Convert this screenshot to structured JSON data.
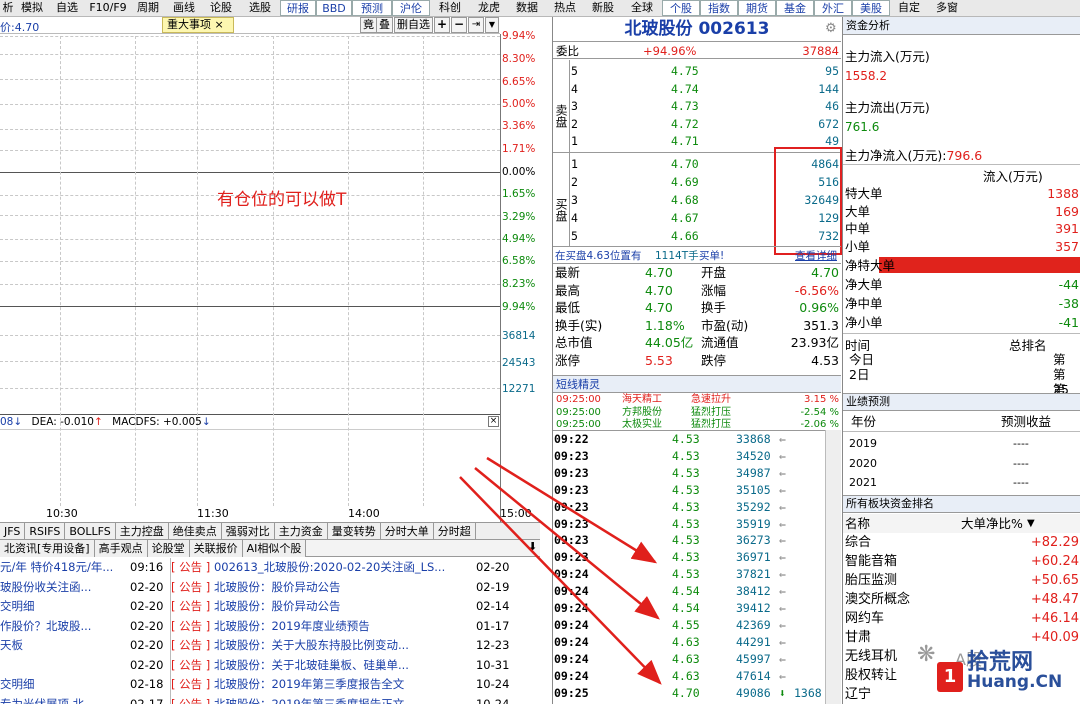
{
  "menu": [
    "析",
    "模拟",
    "自选",
    "F10/F9",
    "周期",
    "画线",
    "论股",
    "选股",
    "研报",
    "BBD",
    "预测",
    "沪伦",
    "科创",
    "龙虎",
    "数据",
    "热点",
    "新股",
    "全球",
    "个股",
    "指数",
    "期货",
    "基金",
    "外汇",
    "美股",
    "自定",
    "多窗"
  ],
  "chart": {
    "price_label": "价:4.70",
    "tag": "重大事项",
    "tag_close": "×",
    "buttons": [
      "竟",
      "叠",
      "删自选"
    ],
    "annotation": "有仓位的可以做T",
    "right_axis": [
      "9.94%",
      "8.30%",
      "6.65%",
      "5.00%",
      "3.36%",
      "1.71%",
      "0.00%",
      "1.65%",
      "3.29%",
      "4.94%",
      "6.58%",
      "8.23%",
      "9.94%"
    ],
    "vol_axis": [
      "36814",
      "24543",
      "12271"
    ],
    "ind_line": {
      "a": "08",
      "dea": "DEA: -0.010",
      "macd": "MACDFS: +0.005"
    },
    "times": [
      "10:30",
      "11:30",
      "14:00",
      "15:00"
    ],
    "ind_tabs": [
      "JFS",
      "RSIFS",
      "BOLLFS",
      "主力控盘",
      "绝佳卖点",
      "强弱对比",
      "主力资金",
      "量变转势",
      "分时大单",
      "分时超"
    ]
  },
  "news": {
    "tabs": [
      "北资讯[专用设备]",
      "高手观点",
      "论股堂",
      "关联报价",
      "AI相似个股"
    ],
    "left": [
      {
        "t": "元/年 特价418元/年...",
        "d": "09:16"
      },
      {
        "t": "玻股份收关注函...",
        "d": "02-20"
      },
      {
        "t": "交明细",
        "d": "02-20"
      },
      {
        "t": "作股价？北玻股...",
        "d": "02-20"
      },
      {
        "t": "天板",
        "d": "02-20"
      },
      {
        "t": "",
        "d": "02-20"
      },
      {
        "t": "交明细",
        "d": "02-18"
      },
      {
        "t": "专为光伏展项 北...",
        "d": "02-17"
      }
    ],
    "right": [
      {
        "tag": "公告",
        "t": "002613_北玻股份:2020-02-20关注函_LS...",
        "d": "02-20"
      },
      {
        "tag": "公告",
        "t": "北玻股份：股价异动公告",
        "d": "02-19"
      },
      {
        "tag": "公告",
        "t": "北玻股份：股价异动公告",
        "d": "02-14"
      },
      {
        "tag": "公告",
        "t": "北玻股份：2019年度业绩预告",
        "d": "01-17"
      },
      {
        "tag": "公告",
        "t": "北玻股份：关于大股东持股比例变动...",
        "d": "12-23"
      },
      {
        "tag": "公告",
        "t": "北玻股份：关于北玻硅巢板、硅巢单...",
        "d": "10-31"
      },
      {
        "tag": "公告",
        "t": "北玻股份：2019年第三季度报告全文",
        "d": "10-24"
      },
      {
        "tag": "公告",
        "t": "北玻股份：2019年第三季度报告正文",
        "d": "10-24"
      }
    ]
  },
  "quote": {
    "name": "北玻股份 002613",
    "weibi": {
      "label": "委比",
      "pct": "+94.96%",
      "val": "37884"
    },
    "sell_label": "卖盘",
    "buy_label": "买盘",
    "sell": [
      {
        "n": "5",
        "p": "4.75",
        "v": "95"
      },
      {
        "n": "4",
        "p": "4.74",
        "v": "144"
      },
      {
        "n": "3",
        "p": "4.73",
        "v": "46"
      },
      {
        "n": "2",
        "p": "4.72",
        "v": "672"
      },
      {
        "n": "1",
        "p": "4.71",
        "v": "49"
      }
    ],
    "buy": [
      {
        "n": "1",
        "p": "4.70",
        "v": "4864"
      },
      {
        "n": "2",
        "p": "4.69",
        "v": "516"
      },
      {
        "n": "3",
        "p": "4.68",
        "v": "32649"
      },
      {
        "n": "4",
        "p": "4.67",
        "v": "129"
      },
      {
        "n": "5",
        "p": "4.66",
        "v": "732"
      }
    ],
    "status": {
      "a": "在买盘4.63位置有",
      "b": "1114T手",
      "c": "买单!",
      "d": "查看详细"
    },
    "stats": [
      [
        "最新",
        "4.70",
        "开盘",
        "4.70"
      ],
      [
        "最高",
        "4.70",
        "涨幅",
        "-6.56%"
      ],
      [
        "最低",
        "4.70",
        "换手",
        "0.96%"
      ],
      [
        "换手(实)",
        "1.18%",
        "市盈(动)",
        "351.3"
      ],
      [
        "总市值",
        "44.05亿",
        "流通值",
        "23.93亿"
      ],
      [
        "涨停",
        "5.53",
        "跌停",
        "4.53"
      ]
    ],
    "sprite_title": "短线精灵",
    "sprite": [
      {
        "t": "09:25:00",
        "n": "海天精工",
        "e": "急速拉升",
        "v": "3.15 %"
      },
      {
        "t": "09:25:00",
        "n": "方邦股份",
        "e": "猛烈打压",
        "v": "-2.54 %"
      },
      {
        "t": "09:25:00",
        "n": "太极实业",
        "e": "猛烈打压",
        "v": "-2.06 %"
      }
    ],
    "ticks": [
      {
        "t": "09:22",
        "p": "4.53",
        "v": "33868"
      },
      {
        "t": "09:23",
        "p": "4.53",
        "v": "34520"
      },
      {
        "t": "09:23",
        "p": "4.53",
        "v": "34987"
      },
      {
        "t": "09:23",
        "p": "4.53",
        "v": "35105"
      },
      {
        "t": "09:23",
        "p": "4.53",
        "v": "35292"
      },
      {
        "t": "09:23",
        "p": "4.53",
        "v": "35919"
      },
      {
        "t": "09:23",
        "p": "4.53",
        "v": "36273"
      },
      {
        "t": "09:23",
        "p": "4.53",
        "v": "36971"
      },
      {
        "t": "09:24",
        "p": "4.53",
        "v": "37821"
      },
      {
        "t": "09:24",
        "p": "4.54",
        "v": "38412"
      },
      {
        "t": "09:24",
        "p": "4.54",
        "v": "39412"
      },
      {
        "t": "09:24",
        "p": "4.55",
        "v": "42369"
      },
      {
        "t": "09:24",
        "p": "4.63",
        "v": "44291"
      },
      {
        "t": "09:24",
        "p": "4.63",
        "v": "45997"
      },
      {
        "t": "09:24",
        "p": "4.63",
        "v": "47614"
      },
      {
        "t": "09:25",
        "p": "4.70",
        "v": "49086",
        "x": "1368"
      }
    ]
  },
  "funds": {
    "title": "资金分析",
    "in_label": "主力流入(万元)",
    "in_val": "1558.2",
    "out_label": "主力流出(万元)",
    "out_val": "761.6",
    "net_label": "主力净流入(万元):",
    "net_val": "796.6",
    "flow_head": "流入(万元)",
    "flow": [
      [
        "特大单",
        "1388"
      ],
      [
        "大单",
        "169"
      ],
      [
        "中单",
        "391"
      ],
      [
        "小单",
        "357"
      ]
    ],
    "net": [
      [
        "净特大单",
        ""
      ],
      [
        "净大单",
        "-44"
      ],
      [
        "净中单",
        "-38"
      ],
      [
        "净小单",
        "-41"
      ]
    ],
    "rank_head": [
      "时间",
      "总排名"
    ],
    "rank": [
      [
        "今日",
        "第"
      ],
      [
        "2日",
        "第25"
      ],
      [
        "",
        "第"
      ]
    ],
    "forecast_title": "业绩预测",
    "forecast_head": [
      "年份",
      "预测收益"
    ],
    "forecast": [
      [
        "2019",
        "----"
      ],
      [
        "2020",
        "----"
      ],
      [
        "2021",
        "----"
      ]
    ],
    "sector_title": "所有板块资金排名",
    "sector_head": [
      "名称",
      "大单净比%"
    ],
    "sectors": [
      [
        "综合",
        "+82.29"
      ],
      [
        "智能音箱",
        "+60.24"
      ],
      [
        "胎压监测",
        "+50.65"
      ],
      [
        "澳交所概念",
        "+48.47"
      ],
      [
        "网约车",
        "+46.14"
      ],
      [
        "甘肃",
        "+40.09"
      ],
      [
        "无线耳机",
        ""
      ],
      [
        "股权转让",
        ""
      ],
      [
        "辽宁",
        ""
      ]
    ]
  },
  "watermark": {
    "a": "拾荒网",
    "b": "Huang.CN",
    "c": "A股"
  }
}
